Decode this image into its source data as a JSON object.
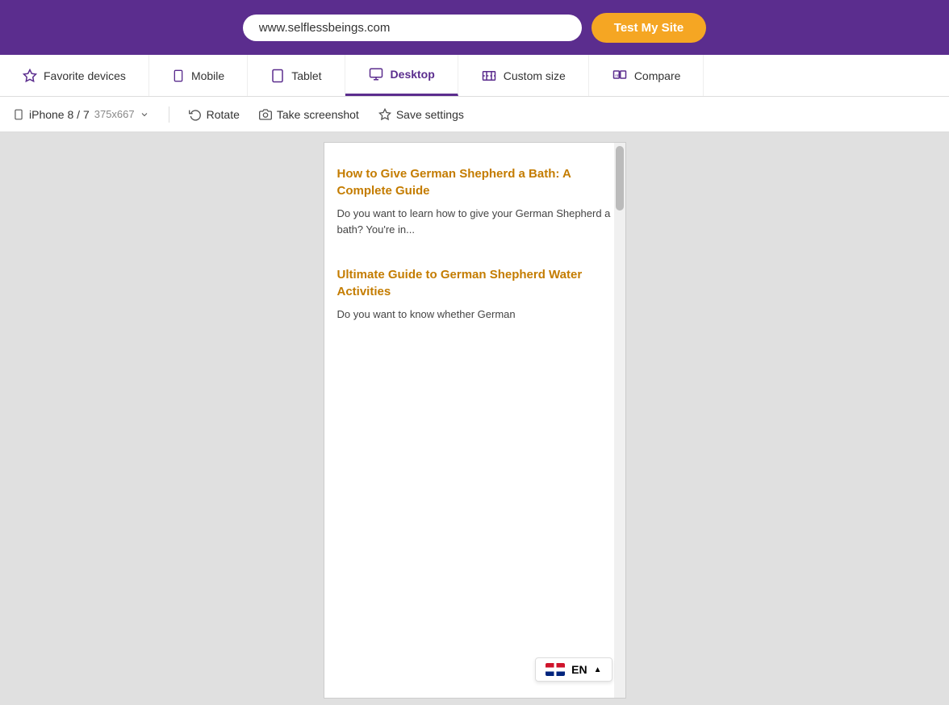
{
  "topbar": {
    "url": "www.selflessbeings.com",
    "test_button_label": "Test My Site"
  },
  "device_nav": {
    "items": [
      {
        "id": "favorite",
        "label": "Favorite devices",
        "active": false
      },
      {
        "id": "mobile",
        "label": "Mobile",
        "active": false
      },
      {
        "id": "tablet",
        "label": "Tablet",
        "active": false
      },
      {
        "id": "desktop",
        "label": "Desktop",
        "active": true
      },
      {
        "id": "custom",
        "label": "Custom size",
        "active": false
      },
      {
        "id": "compare",
        "label": "Compare",
        "active": false
      }
    ]
  },
  "toolbar": {
    "device_name": "iPhone 8 / 7",
    "device_size": "375x667",
    "rotate_label": "Rotate",
    "screenshot_label": "Take screenshot",
    "save_label": "Save settings"
  },
  "preview": {
    "articles": [
      {
        "title": "How to Give German Shepherd a Bath: A Complete Guide",
        "excerpt": "Do you want to learn how to give your German Shepherd a bath? You're in...",
        "image_type": "bath"
      },
      {
        "title": "Ultimate Guide to German Shepherd Water Activities",
        "excerpt": "Do you want to know whether German",
        "image_type": "water"
      }
    ],
    "lang_switcher": {
      "code": "EN",
      "chevron": "▲"
    }
  },
  "colors": {
    "purple": "#5b2d8e",
    "gold": "#f5a623",
    "link": "#c47c00"
  }
}
